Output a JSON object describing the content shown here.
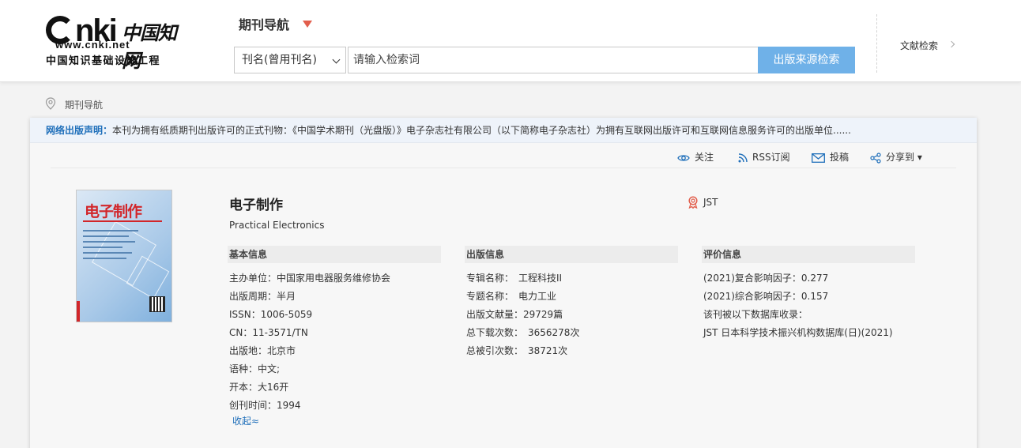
{
  "header": {
    "logo": {
      "cnki": "nki",
      "cn_name": "中国知网",
      "url": "www.cnki.net",
      "subtitle": "中国知识基础设施工程"
    },
    "nav_title": "期刊导航",
    "search": {
      "select_value": "刊名(曾用刊名)",
      "placeholder": "请输入检索词",
      "button": "出版来源检索"
    },
    "doc_search": "文献检索"
  },
  "breadcrumb": "期刊导航",
  "notice": {
    "label": "网络出版声明：",
    "text": "本刊为拥有纸质期刊出版许可的正式刊物：《中国学术期刊（光盘版）》电子杂志社有限公司（以下简称电子杂志社）为拥有互联网出版许可和互联网信息服务许可的出版单位......"
  },
  "actions": {
    "follow": "关注",
    "rss": "RSS订阅",
    "submit": "投稿",
    "share": "分享到 ▾"
  },
  "cover": {
    "title": "电子制作"
  },
  "journal": {
    "title": "电子制作",
    "english": "Practical Electronics",
    "badge": "JST"
  },
  "basic": {
    "heading": "基本信息",
    "fields": [
      "主办单位：中国家用电器服务维修协会",
      "出版周期：半月",
      "ISSN：1006-5059",
      "CN：11-3571/TN",
      "出版地：北京市",
      "语种：中文;",
      "开本：大16开",
      "创刊时间：1994"
    ]
  },
  "publish": {
    "heading": "出版信息",
    "fields": [
      "专辑名称：　工程科技II",
      "专题名称：　电力工业",
      "出版文献量：29729篇",
      "总下载次数：　3656278次",
      "总被引次数：　38721次"
    ]
  },
  "evaluation": {
    "heading": "评价信息",
    "fields": [
      "(2021)复合影响因子：0.277",
      "(2021)综合影响因子：0.157",
      "该刊被以下数据库收录：",
      "JST 日本科学技术振兴机构数据库(日)(2021)"
    ]
  },
  "collapse": "收起≈",
  "colors": {
    "accent_blue": "#1f6fba",
    "search_button": "#6fb1e8",
    "nav_caret": "#e25e4c",
    "cover_red": "#d2262a"
  }
}
